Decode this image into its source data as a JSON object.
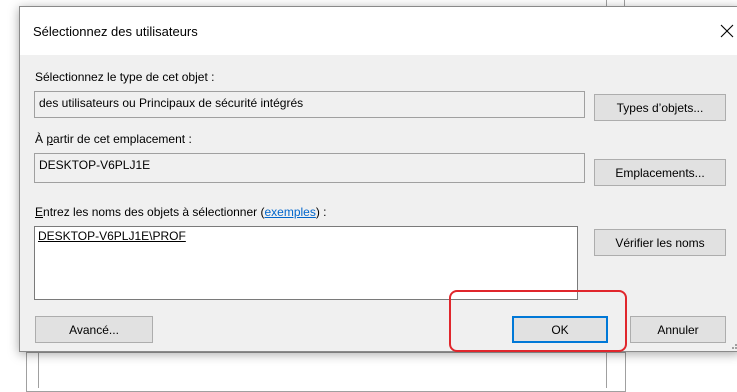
{
  "dialog": {
    "title": "Sélectionnez des utilisateurs",
    "object_type": {
      "label": "Sélectionnez le type de cet objet :",
      "value": "des utilisateurs ou Principaux de sécurité intégrés",
      "button": "Types d’objets..."
    },
    "location": {
      "label_prefix": "À",
      "label_underlined": "p",
      "label_rest": "artir de cet emplacement :",
      "value": "DESKTOP-V6PLJ1E",
      "button": "Emplacements..."
    },
    "names": {
      "label_underlined": "E",
      "label_text": "ntrez les noms des objets à sélectionner (",
      "label_link": "exemples",
      "label_end": ") :",
      "value": "DESKTOP-V6PLJ1E\\PROF",
      "check_button": "Vérifier les noms"
    },
    "advanced_button": "Avancé...",
    "ok_button": "OK",
    "cancel_button": "Annuler"
  },
  "icons": {
    "close": "close-icon",
    "grip": "resize-grip-icon"
  },
  "colors": {
    "highlight": "#e0262c",
    "link": "#0066cc",
    "focus": "#0078d7"
  }
}
